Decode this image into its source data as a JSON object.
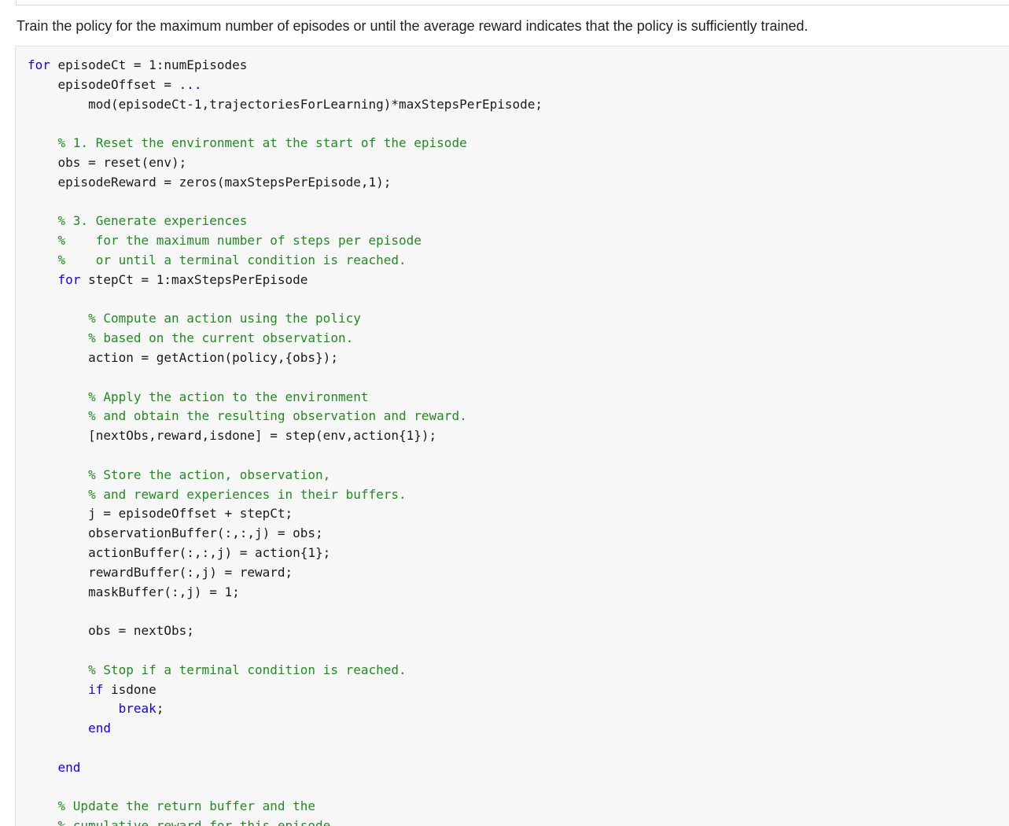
{
  "intro_text": "Train the policy for the maximum number of episodes or until the average reward indicates that the policy is sufficiently trained.",
  "code_lines": [
    {
      "indent": "",
      "parts": [
        {
          "type": "keyword",
          "text": "for"
        },
        {
          "type": "code",
          "text": " episodeCt = 1:numEpisodes"
        }
      ]
    },
    {
      "indent": "    ",
      "parts": [
        {
          "type": "code",
          "text": "episodeOffset = "
        },
        {
          "type": "keyword",
          "text": "..."
        }
      ]
    },
    {
      "indent": "        ",
      "parts": [
        {
          "type": "code",
          "text": "mod(episodeCt-1,trajectoriesForLearning)*maxStepsPerEpisode;"
        }
      ]
    },
    {
      "indent": "",
      "parts": []
    },
    {
      "indent": "    ",
      "parts": [
        {
          "type": "comment",
          "text": "% 1. Reset the environment at the start of the episode"
        }
      ]
    },
    {
      "indent": "    ",
      "parts": [
        {
          "type": "code",
          "text": "obs = reset(env);"
        }
      ]
    },
    {
      "indent": "    ",
      "parts": [
        {
          "type": "code",
          "text": "episodeReward = zeros(maxStepsPerEpisode,1);"
        }
      ]
    },
    {
      "indent": "",
      "parts": []
    },
    {
      "indent": "    ",
      "parts": [
        {
          "type": "comment",
          "text": "% 3. Generate experiences"
        }
      ]
    },
    {
      "indent": "    ",
      "parts": [
        {
          "type": "comment",
          "text": "%    for the maximum number of steps per episode"
        }
      ]
    },
    {
      "indent": "    ",
      "parts": [
        {
          "type": "comment",
          "text": "%    or until a terminal condition is reached."
        }
      ]
    },
    {
      "indent": "    ",
      "parts": [
        {
          "type": "keyword",
          "text": "for"
        },
        {
          "type": "code",
          "text": " stepCt = 1:maxStepsPerEpisode"
        }
      ]
    },
    {
      "indent": "",
      "parts": []
    },
    {
      "indent": "        ",
      "parts": [
        {
          "type": "comment",
          "text": "% Compute an action using the policy"
        }
      ]
    },
    {
      "indent": "        ",
      "parts": [
        {
          "type": "comment",
          "text": "% based on the current observation."
        }
      ]
    },
    {
      "indent": "        ",
      "parts": [
        {
          "type": "code",
          "text": "action = getAction(policy,{obs});"
        }
      ]
    },
    {
      "indent": "",
      "parts": []
    },
    {
      "indent": "        ",
      "parts": [
        {
          "type": "comment",
          "text": "% Apply the action to the environment"
        }
      ]
    },
    {
      "indent": "        ",
      "parts": [
        {
          "type": "comment",
          "text": "% and obtain the resulting observation and reward."
        }
      ]
    },
    {
      "indent": "        ",
      "parts": [
        {
          "type": "code",
          "text": "[nextObs,reward,isdone] = step(env,action{1});"
        }
      ]
    },
    {
      "indent": "",
      "parts": []
    },
    {
      "indent": "        ",
      "parts": [
        {
          "type": "comment",
          "text": "% Store the action, observation,"
        }
      ]
    },
    {
      "indent": "        ",
      "parts": [
        {
          "type": "comment",
          "text": "% and reward experiences in their buffers."
        }
      ]
    },
    {
      "indent": "        ",
      "parts": [
        {
          "type": "code",
          "text": "j = episodeOffset + stepCt;"
        }
      ]
    },
    {
      "indent": "        ",
      "parts": [
        {
          "type": "code",
          "text": "observationBuffer(:,:,j) = obs;"
        }
      ]
    },
    {
      "indent": "        ",
      "parts": [
        {
          "type": "code",
          "text": "actionBuffer(:,:,j) = action{1};"
        }
      ]
    },
    {
      "indent": "        ",
      "parts": [
        {
          "type": "code",
          "text": "rewardBuffer(:,j) = reward;"
        }
      ]
    },
    {
      "indent": "        ",
      "parts": [
        {
          "type": "code",
          "text": "maskBuffer(:,j) = 1;"
        }
      ]
    },
    {
      "indent": "",
      "parts": []
    },
    {
      "indent": "        ",
      "parts": [
        {
          "type": "code",
          "text": "obs = nextObs;"
        }
      ]
    },
    {
      "indent": "",
      "parts": []
    },
    {
      "indent": "        ",
      "parts": [
        {
          "type": "comment",
          "text": "% Stop if a terminal condition is reached."
        }
      ]
    },
    {
      "indent": "        ",
      "parts": [
        {
          "type": "keyword",
          "text": "if"
        },
        {
          "type": "code",
          "text": " isdone"
        }
      ]
    },
    {
      "indent": "            ",
      "parts": [
        {
          "type": "keyword",
          "text": "break"
        },
        {
          "type": "code",
          "text": ";"
        }
      ]
    },
    {
      "indent": "        ",
      "parts": [
        {
          "type": "keyword",
          "text": "end"
        }
      ]
    },
    {
      "indent": "",
      "parts": []
    },
    {
      "indent": "    ",
      "parts": [
        {
          "type": "keyword",
          "text": "end"
        }
      ]
    },
    {
      "indent": "",
      "parts": []
    },
    {
      "indent": "    ",
      "parts": [
        {
          "type": "comment",
          "text": "% Update the return buffer and the"
        }
      ]
    },
    {
      "indent": "    ",
      "parts": [
        {
          "type": "comment",
          "text": "% cumulative reward for this episode."
        }
      ]
    }
  ]
}
